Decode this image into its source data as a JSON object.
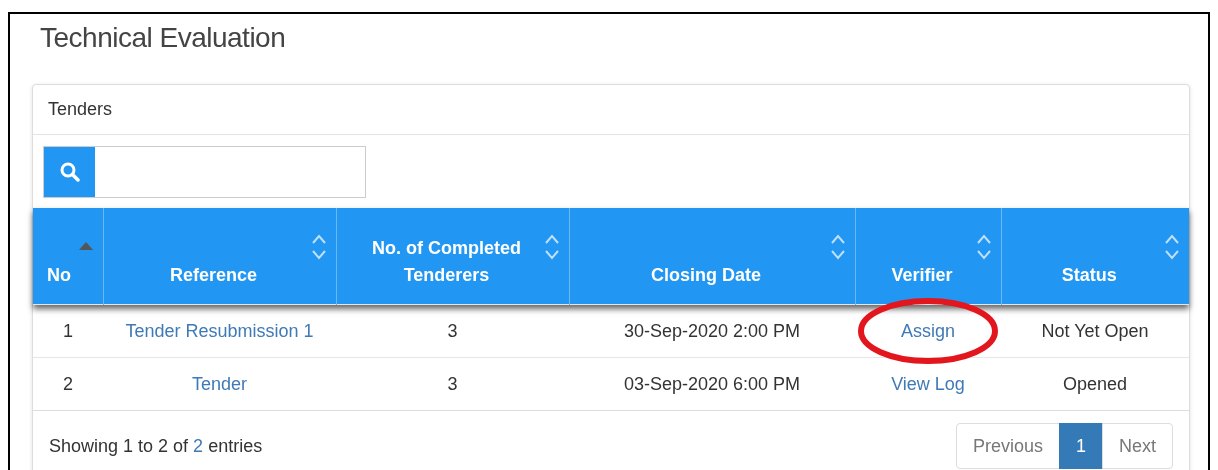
{
  "page": {
    "title": "Technical Evaluation"
  },
  "panel": {
    "heading": "Tenders"
  },
  "table": {
    "columns": [
      {
        "label": "No",
        "sorted": true
      },
      {
        "label": "Reference",
        "sorted": false
      },
      {
        "label": "No. of Completed Tenderers",
        "sorted": false
      },
      {
        "label": "Closing Date",
        "sorted": false
      },
      {
        "label": "Verifier",
        "sorted": false
      },
      {
        "label": "Status",
        "sorted": false
      }
    ],
    "rows": [
      {
        "no": "1",
        "reference": "Tender Resubmission 1",
        "completed": "3",
        "closing_date": "30-Sep-2020 2:00 PM",
        "verifier": {
          "label": "Assign",
          "circled": true
        },
        "status": "Not Yet Open"
      },
      {
        "no": "2",
        "reference": "Tender",
        "completed": "3",
        "closing_date": "03-Sep-2020 6:00 PM",
        "verifier": {
          "label": "View Log",
          "circled": false
        },
        "status": "Opened"
      }
    ]
  },
  "footer": {
    "info_parts": [
      "Showing 1 to 2 of ",
      "2",
      " entries"
    ],
    "pagination": [
      {
        "label": "Previous",
        "selected": false
      },
      {
        "label": "1",
        "selected": true
      },
      {
        "label": "Next",
        "selected": false
      }
    ]
  }
}
